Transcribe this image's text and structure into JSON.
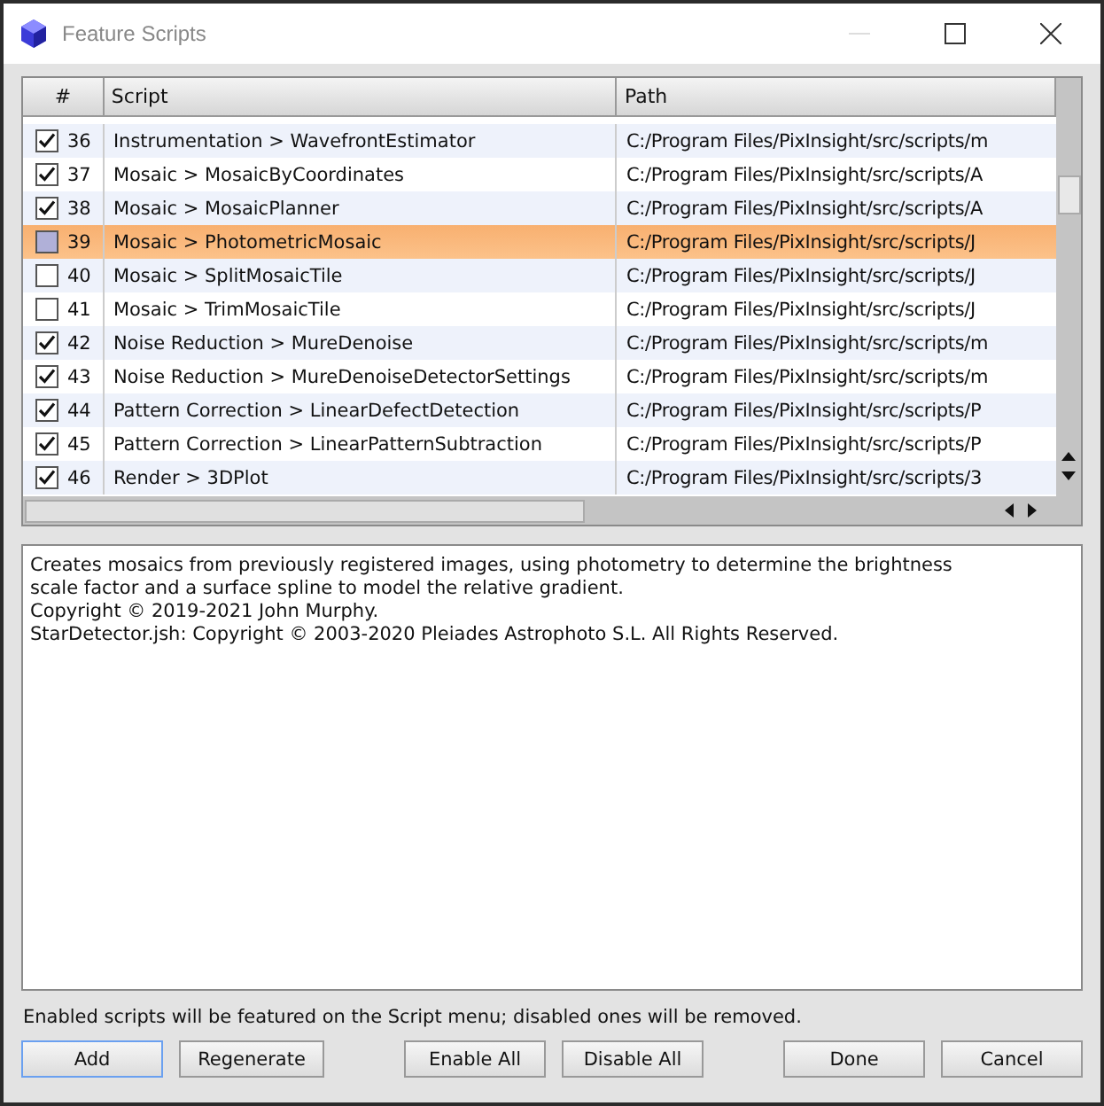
{
  "window": {
    "title": "Feature Scripts"
  },
  "table": {
    "columns": [
      "#",
      "Script",
      "Path"
    ],
    "rows": [
      {
        "checked": true,
        "selected": false,
        "number": "36",
        "script": "Instrumentation > WavefrontEstimator",
        "path": "C:/Program Files/PixInsight/src/scripts/m"
      },
      {
        "checked": true,
        "selected": false,
        "number": "37",
        "script": "Mosaic > MosaicByCoordinates",
        "path": "C:/Program Files/PixInsight/src/scripts/A"
      },
      {
        "checked": true,
        "selected": false,
        "number": "38",
        "script": "Mosaic > MosaicPlanner",
        "path": "C:/Program Files/PixInsight/src/scripts/A"
      },
      {
        "checked": false,
        "selected": true,
        "number": "39",
        "script": "Mosaic > PhotometricMosaic",
        "path": "C:/Program Files/PixInsight/src/scripts/J"
      },
      {
        "checked": false,
        "selected": false,
        "number": "40",
        "script": "Mosaic > SplitMosaicTile",
        "path": "C:/Program Files/PixInsight/src/scripts/J"
      },
      {
        "checked": false,
        "selected": false,
        "number": "41",
        "script": "Mosaic > TrimMosaicTile",
        "path": "C:/Program Files/PixInsight/src/scripts/J"
      },
      {
        "checked": true,
        "selected": false,
        "number": "42",
        "script": "Noise Reduction > MureDenoise",
        "path": "C:/Program Files/PixInsight/src/scripts/m"
      },
      {
        "checked": true,
        "selected": false,
        "number": "43",
        "script": "Noise Reduction > MureDenoiseDetectorSettings",
        "path": "C:/Program Files/PixInsight/src/scripts/m"
      },
      {
        "checked": true,
        "selected": false,
        "number": "44",
        "script": "Pattern Correction > LinearDefectDetection",
        "path": "C:/Program Files/PixInsight/src/scripts/P"
      },
      {
        "checked": true,
        "selected": false,
        "number": "45",
        "script": "Pattern Correction > LinearPatternSubtraction",
        "path": "C:/Program Files/PixInsight/src/scripts/P"
      },
      {
        "checked": true,
        "selected": false,
        "number": "46",
        "script": "Render > 3DPlot",
        "path": "C:/Program Files/PixInsight/src/scripts/3"
      }
    ]
  },
  "description": [
    "Creates mosaics from previously registered images, using photometry to determine the brightness scale factor and a surface spline to model the relative gradient.",
    "Copyright © 2019-2021 John Murphy.",
    "StarDetector.jsh: Copyright © 2003-2020 Pleiades Astrophoto S.L. All Rights Reserved."
  ],
  "hint": "Enabled scripts will be featured on the Script menu; disabled ones will be removed.",
  "buttons": [
    {
      "label": "Add",
      "kind": "default"
    },
    {
      "label": "Regenerate",
      "kind": "normal"
    },
    {
      "label": "Enable All",
      "kind": "normal"
    },
    {
      "label": "Disable All",
      "kind": "normal"
    },
    {
      "label": "Done",
      "kind": "normal"
    },
    {
      "label": "Cancel",
      "kind": "normal"
    }
  ]
}
